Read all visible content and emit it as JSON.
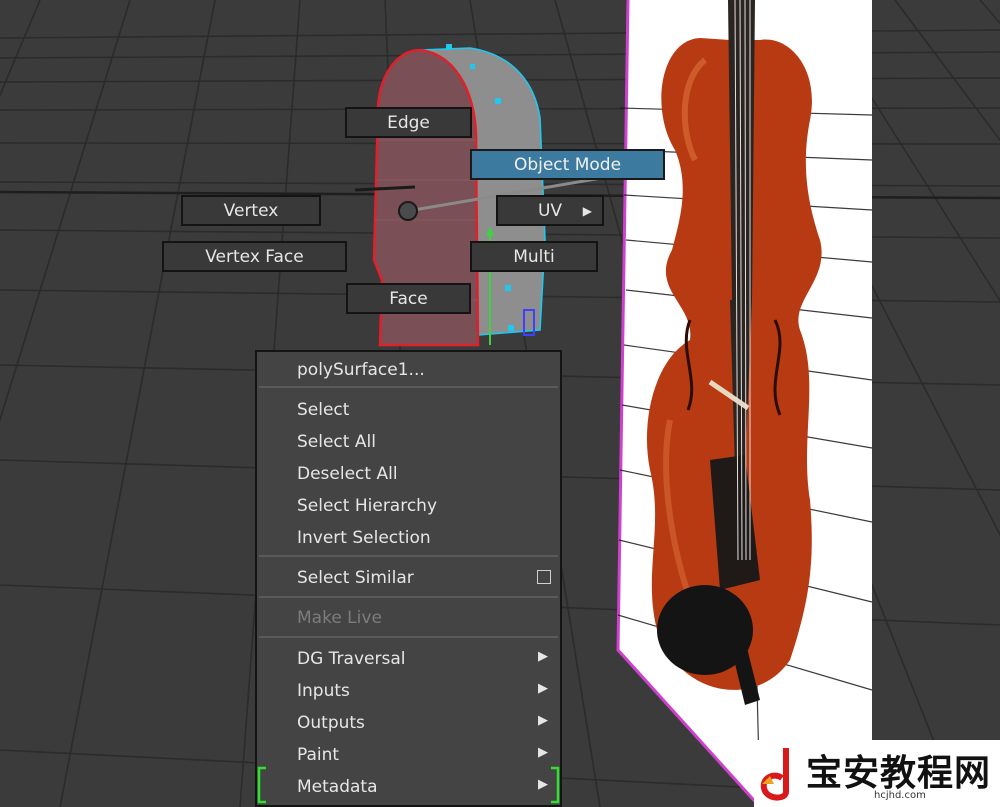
{
  "marking_menu": {
    "edge": "Edge",
    "object_mode": "Object Mode",
    "vertex": "Vertex",
    "uv": "UV",
    "vertex_face": "Vertex Face",
    "multi": "Multi",
    "face": "Face"
  },
  "context_menu": {
    "header": "polySurface1...",
    "items": {
      "select": "Select",
      "select_all": "Select All",
      "deselect_all": "Deselect All",
      "select_hierarchy": "Select Hierarchy",
      "invert_selection": "Invert Selection",
      "select_similar": "Select Similar",
      "make_live": "Make Live",
      "dg_traversal": "DG Traversal",
      "inputs": "Inputs",
      "outputs": "Outputs",
      "paint": "Paint",
      "metadata": "Metadata"
    }
  },
  "watermark": {
    "text": "宝安教程网",
    "sub": "hcjhd.com"
  },
  "colors": {
    "viewport_bg": "#3b3b3b",
    "grid": "#2a2a2a",
    "selection_red": "#e0202a",
    "highlight_cyan": "#1ec8f0",
    "active_item": "#3c7aa0",
    "image_plane_border": "#d040d0"
  }
}
